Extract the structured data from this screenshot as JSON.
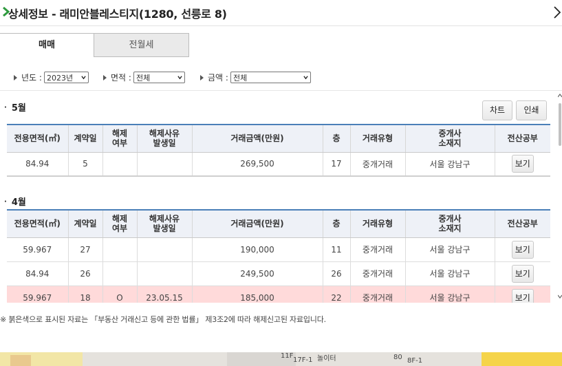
{
  "header": {
    "title": "상세정보 - 래미안블레스티지(1280, 선릉로 8)"
  },
  "tabs": [
    {
      "label": "매매",
      "active": true
    },
    {
      "label": "전월세",
      "active": false
    }
  ],
  "filters": {
    "year": {
      "label": "년도 :",
      "value": "2023년"
    },
    "area": {
      "label": "면적 :",
      "value": "전체"
    },
    "amount": {
      "label": "금액 :",
      "value": "전체"
    }
  },
  "buttons": {
    "chart": "차트",
    "print": "인쇄"
  },
  "columns": [
    "전용면적(㎡)",
    "계약일",
    "해제\n여부",
    "해제사유\n발생일",
    "거래금액(만원)",
    "층",
    "거래유형",
    "중개사\n소재지",
    "전산공부"
  ],
  "sections": [
    {
      "month": "5월",
      "rows": [
        {
          "area": "84.94",
          "day": "5",
          "cancel": "",
          "cancel_date": "",
          "price": "269,500",
          "floor": "17",
          "type": "중개거래",
          "location": "서울 강남구",
          "view": "보기",
          "cancelled": false
        }
      ]
    },
    {
      "month": "4월",
      "rows": [
        {
          "area": "59.967",
          "day": "27",
          "cancel": "",
          "cancel_date": "",
          "price": "190,000",
          "floor": "11",
          "type": "중개거래",
          "location": "서울 강남구",
          "view": "보기",
          "cancelled": false
        },
        {
          "area": "84.94",
          "day": "26",
          "cancel": "",
          "cancel_date": "",
          "price": "249,500",
          "floor": "26",
          "type": "중개거래",
          "location": "서울 강남구",
          "view": "보기",
          "cancelled": false
        },
        {
          "area": "59.967",
          "day": "18",
          "cancel": "O",
          "cancel_date": "23.05.15",
          "price": "185,000",
          "floor": "22",
          "type": "중개거래",
          "location": "서울 강남구",
          "view": "보기",
          "cancelled": true
        }
      ]
    }
  ],
  "note": "※ 붉은색으로 표시된 자료는 「부동산 거래신고 등에 관한 법률」 제3조2에 따라 해제신고된 자료입니다.",
  "map": {
    "labels": [
      "11F",
      "17F-1",
      "놀이터",
      "80",
      "8F-1"
    ]
  },
  "colors": {
    "accent_green": "#2e9a3e",
    "header_border": "#4a7fb8",
    "cancel_row": "#ffdada"
  }
}
